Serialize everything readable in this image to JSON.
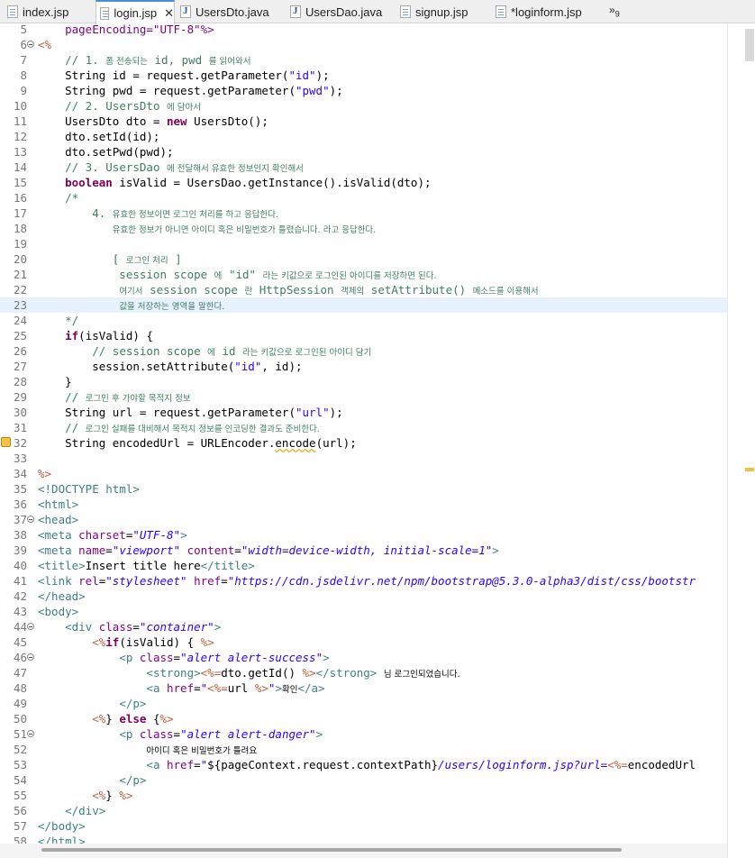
{
  "tabs": [
    {
      "label": "index.jsp",
      "icon": "jsp-file-icon"
    },
    {
      "label": "login.jsp",
      "icon": "jsp-file-icon",
      "active": true
    },
    {
      "label": "UsersDto.java",
      "icon": "java-file-icon"
    },
    {
      "label": "UsersDao.java",
      "icon": "java-file-icon"
    },
    {
      "label": "signup.jsp",
      "icon": "jsp-file-icon"
    },
    {
      "label": "*loginform.jsp",
      "icon": "jsp-file-icon"
    }
  ],
  "overflow": {
    "chevron": "»",
    "count": "9"
  },
  "colors": {
    "keyword": "#7f0055",
    "string": "#2a00ff",
    "comment": "#3f7f5f",
    "tag": "#3f7f7f",
    "attribute": "#7f007f",
    "jsp_delimiter": "#bf5f3f",
    "current_line": "#e8f2fe"
  },
  "editor": {
    "current_line": 23,
    "warning_line": 32,
    "lines": [
      {
        "n": "5",
        "segs": [
          {
            "t": "    pageEncoding=\"UTF-8\"%>",
            "c": "attr"
          }
        ]
      },
      {
        "n": "6",
        "fold": true,
        "segs": [
          {
            "t": "<%",
            "c": "jsp"
          }
        ]
      },
      {
        "n": "7",
        "segs": [
          {
            "t": "    "
          },
          {
            "t": "// 1. ",
            "c": "cm"
          },
          {
            "t": "폼 전송되는",
            "c": "cm ko"
          },
          {
            "t": " id, pwd ",
            "c": "cm"
          },
          {
            "t": "를 읽어와서",
            "c": "cm ko"
          }
        ]
      },
      {
        "n": "8",
        "segs": [
          {
            "t": "    String id = request.getParameter("
          },
          {
            "t": "\"id\"",
            "c": "str"
          },
          {
            "t": ");"
          }
        ]
      },
      {
        "n": "9",
        "segs": [
          {
            "t": "    String pwd = request.getParameter("
          },
          {
            "t": "\"pwd\"",
            "c": "str"
          },
          {
            "t": ");"
          }
        ]
      },
      {
        "n": "10",
        "segs": [
          {
            "t": "    "
          },
          {
            "t": "// 2. UsersDto ",
            "c": "cm"
          },
          {
            "t": "에 담아서",
            "c": "cm ko"
          }
        ]
      },
      {
        "n": "11",
        "segs": [
          {
            "t": "    UsersDto dto = "
          },
          {
            "t": "new",
            "c": "kw"
          },
          {
            "t": " UsersDto();"
          }
        ]
      },
      {
        "n": "12",
        "segs": [
          {
            "t": "    dto.setId(id);"
          }
        ]
      },
      {
        "n": "13",
        "segs": [
          {
            "t": "    dto.setPwd(pwd);"
          }
        ]
      },
      {
        "n": "14",
        "segs": [
          {
            "t": "    "
          },
          {
            "t": "// 3. UsersDao ",
            "c": "cm"
          },
          {
            "t": "에 전달해서 유효한 정보인지 확인해서",
            "c": "cm ko"
          }
        ]
      },
      {
        "n": "15",
        "segs": [
          {
            "t": "    "
          },
          {
            "t": "boolean",
            "c": "kw"
          },
          {
            "t": " isValid = UsersDao.getInstance().isValid(dto);"
          }
        ]
      },
      {
        "n": "16",
        "segs": [
          {
            "t": "    /*",
            "c": "cm"
          }
        ]
      },
      {
        "n": "17",
        "segs": [
          {
            "t": "        4. ",
            "c": "cm"
          },
          {
            "t": "유효한 정보이면 로그인 처리를 하고 응답한다.",
            "c": "cm ko"
          }
        ]
      },
      {
        "n": "18",
        "segs": [
          {
            "t": "           ",
            "c": "cm"
          },
          {
            "t": "유효한 정보가 아니면 아이디 혹은 비밀번호가 틀렸습니다. 라고 응답한다.",
            "c": "cm ko"
          }
        ]
      },
      {
        "n": "19",
        "segs": []
      },
      {
        "n": "20",
        "segs": [
          {
            "t": "           [ ",
            "c": "cm"
          },
          {
            "t": "로그인 처리",
            "c": "cm ko"
          },
          {
            "t": " ]",
            "c": "cm"
          }
        ]
      },
      {
        "n": "21",
        "segs": [
          {
            "t": "            session scope ",
            "c": "cm"
          },
          {
            "t": "에",
            "c": "cm ko"
          },
          {
            "t": " \"id\" ",
            "c": "cm"
          },
          {
            "t": "라는 키값으로 로그인된 아이디를 저장하면 된다.",
            "c": "cm ko"
          }
        ]
      },
      {
        "n": "22",
        "segs": [
          {
            "t": "            ",
            "c": "cm"
          },
          {
            "t": "여기서",
            "c": "cm ko"
          },
          {
            "t": " session scope ",
            "c": "cm"
          },
          {
            "t": "란",
            "c": "cm ko"
          },
          {
            "t": " HttpSession ",
            "c": "cm"
          },
          {
            "t": "객체의",
            "c": "cm ko"
          },
          {
            "t": " setAttribute() ",
            "c": "cm"
          },
          {
            "t": "메소드를 이용해서",
            "c": "cm ko"
          }
        ]
      },
      {
        "n": "23",
        "segs": [
          {
            "t": "            ",
            "c": "cm"
          },
          {
            "t": "값을 저장하는 영역을 말한다.",
            "c": "cm ko"
          }
        ]
      },
      {
        "n": "24",
        "segs": [
          {
            "t": "    */",
            "c": "cm"
          }
        ]
      },
      {
        "n": "25",
        "segs": [
          {
            "t": "    "
          },
          {
            "t": "if",
            "c": "kw"
          },
          {
            "t": "(isValid) {"
          }
        ]
      },
      {
        "n": "26",
        "segs": [
          {
            "t": "        "
          },
          {
            "t": "// session scope ",
            "c": "cm"
          },
          {
            "t": "에",
            "c": "cm ko"
          },
          {
            "t": " id ",
            "c": "cm"
          },
          {
            "t": "라는 키값으로 로그인된 아이디 담기",
            "c": "cm ko"
          }
        ]
      },
      {
        "n": "27",
        "segs": [
          {
            "t": "        session.setAttribute("
          },
          {
            "t": "\"id\"",
            "c": "str"
          },
          {
            "t": ", id);"
          }
        ]
      },
      {
        "n": "28",
        "segs": [
          {
            "t": "    }"
          }
        ]
      },
      {
        "n": "29",
        "segs": [
          {
            "t": "    "
          },
          {
            "t": "// ",
            "c": "cm"
          },
          {
            "t": "로그인 후 가야할 목적지 정보",
            "c": "cm ko"
          }
        ]
      },
      {
        "n": "30",
        "segs": [
          {
            "t": "    String url = request.getParameter("
          },
          {
            "t": "\"url\"",
            "c": "str"
          },
          {
            "t": ");"
          }
        ]
      },
      {
        "n": "31",
        "segs": [
          {
            "t": "    "
          },
          {
            "t": "// ",
            "c": "cm"
          },
          {
            "t": "로그인 실패를 대비해서 목적지 정보를 인코딩한 결과도 준비한다.",
            "c": "cm ko"
          }
        ]
      },
      {
        "n": "32",
        "warn": true,
        "segs": [
          {
            "t": "    String encodedUrl = URLEncoder."
          },
          {
            "t": "encode",
            "c": "wavy"
          },
          {
            "t": "(url);"
          }
        ]
      },
      {
        "n": "33",
        "segs": []
      },
      {
        "n": "34",
        "segs": [
          {
            "t": "%>",
            "c": "jsp"
          }
        ]
      },
      {
        "n": "35",
        "segs": [
          {
            "t": "<!DOCTYPE html>",
            "c": "tag"
          }
        ]
      },
      {
        "n": "36",
        "segs": [
          {
            "t": "<html>",
            "c": "tag"
          }
        ]
      },
      {
        "n": "37",
        "fold": true,
        "segs": [
          {
            "t": "<head>",
            "c": "tag"
          }
        ]
      },
      {
        "n": "38",
        "segs": [
          {
            "t": "<meta ",
            "c": "tag"
          },
          {
            "t": "charset",
            "c": "attr"
          },
          {
            "t": "="
          },
          {
            "t": "\"UTF-8\"",
            "c": "aval"
          },
          {
            "t": ">",
            "c": "tag"
          }
        ]
      },
      {
        "n": "39",
        "segs": [
          {
            "t": "<meta ",
            "c": "tag"
          },
          {
            "t": "name",
            "c": "attr"
          },
          {
            "t": "="
          },
          {
            "t": "\"viewport\"",
            "c": "aval"
          },
          {
            "t": " "
          },
          {
            "t": "content",
            "c": "attr"
          },
          {
            "t": "="
          },
          {
            "t": "\"width=device-width, initial-scale=1\"",
            "c": "aval"
          },
          {
            "t": ">",
            "c": "tag"
          }
        ]
      },
      {
        "n": "40",
        "segs": [
          {
            "t": "<title>",
            "c": "tag"
          },
          {
            "t": "Insert title here"
          },
          {
            "t": "</title>",
            "c": "tag"
          }
        ]
      },
      {
        "n": "41",
        "segs": [
          {
            "t": "<link ",
            "c": "tag"
          },
          {
            "t": "rel",
            "c": "attr"
          },
          {
            "t": "="
          },
          {
            "t": "\"stylesheet\"",
            "c": "aval"
          },
          {
            "t": " "
          },
          {
            "t": "href",
            "c": "attr"
          },
          {
            "t": "="
          },
          {
            "t": "\"https://cdn.jsdelivr.net/npm/bootstrap@5.3.0-alpha3/dist/css/bootstr",
            "c": "aval"
          }
        ]
      },
      {
        "n": "42",
        "segs": [
          {
            "t": "</head>",
            "c": "tag"
          }
        ]
      },
      {
        "n": "43",
        "segs": [
          {
            "t": "<body>",
            "c": "tag"
          }
        ]
      },
      {
        "n": "44",
        "fold": true,
        "segs": [
          {
            "t": "    "
          },
          {
            "t": "<div ",
            "c": "tag"
          },
          {
            "t": "class",
            "c": "attr"
          },
          {
            "t": "="
          },
          {
            "t": "\"container\"",
            "c": "aval"
          },
          {
            "t": ">",
            "c": "tag"
          }
        ]
      },
      {
        "n": "45",
        "segs": [
          {
            "t": "        "
          },
          {
            "t": "<%",
            "c": "jsp"
          },
          {
            "t": "if",
            "c": "kw"
          },
          {
            "t": "(isValid) { "
          },
          {
            "t": "%>",
            "c": "jsp"
          }
        ]
      },
      {
        "n": "46",
        "fold": true,
        "segs": [
          {
            "t": "            "
          },
          {
            "t": "<p ",
            "c": "tag"
          },
          {
            "t": "class",
            "c": "attr"
          },
          {
            "t": "="
          },
          {
            "t": "\"alert alert-success\"",
            "c": "aval"
          },
          {
            "t": ">",
            "c": "tag"
          }
        ]
      },
      {
        "n": "47",
        "segs": [
          {
            "t": "                "
          },
          {
            "t": "<strong>",
            "c": "tag"
          },
          {
            "t": "<%=",
            "c": "jsp"
          },
          {
            "t": "dto.getId() "
          },
          {
            "t": "%>",
            "c": "jsp"
          },
          {
            "t": "</strong>",
            "c": "tag"
          },
          {
            "t": " "
          },
          {
            "t": "님 로그인되었습니다.",
            "c": "ko"
          }
        ]
      },
      {
        "n": "48",
        "segs": [
          {
            "t": "                "
          },
          {
            "t": "<a ",
            "c": "tag"
          },
          {
            "t": "href",
            "c": "attr"
          },
          {
            "t": "="
          },
          {
            "t": "\"",
            "c": "aval"
          },
          {
            "t": "<%=",
            "c": "jsp"
          },
          {
            "t": "url "
          },
          {
            "t": "%>",
            "c": "jsp"
          },
          {
            "t": "\"",
            "c": "aval"
          },
          {
            "t": ">",
            "c": "tag"
          },
          {
            "t": "확인",
            "c": "ko"
          },
          {
            "t": "</a>",
            "c": "tag"
          }
        ]
      },
      {
        "n": "49",
        "segs": [
          {
            "t": "            "
          },
          {
            "t": "</p>",
            "c": "tag"
          }
        ]
      },
      {
        "n": "50",
        "segs": [
          {
            "t": "        "
          },
          {
            "t": "<%",
            "c": "jsp"
          },
          {
            "t": "} "
          },
          {
            "t": "else",
            "c": "kw"
          },
          {
            "t": " {"
          },
          {
            "t": "%>",
            "c": "jsp"
          }
        ]
      },
      {
        "n": "51",
        "fold": true,
        "segs": [
          {
            "t": "            "
          },
          {
            "t": "<p ",
            "c": "tag"
          },
          {
            "t": "class",
            "c": "attr"
          },
          {
            "t": "="
          },
          {
            "t": "\"alert alert-danger\"",
            "c": "aval"
          },
          {
            "t": ">",
            "c": "tag"
          }
        ]
      },
      {
        "n": "52",
        "segs": [
          {
            "t": "                "
          },
          {
            "t": "아이디 혹은 비밀번호가 틀려요",
            "c": "ko"
          }
        ]
      },
      {
        "n": "53",
        "segs": [
          {
            "t": "                "
          },
          {
            "t": "<a ",
            "c": "tag"
          },
          {
            "t": "href",
            "c": "attr"
          },
          {
            "t": "="
          },
          {
            "t": "\"",
            "c": "aval"
          },
          {
            "t": "${pageContext.request.contextPath}"
          },
          {
            "t": "/users/loginform.jsp?url=",
            "c": "aval"
          },
          {
            "t": "<%=",
            "c": "jsp"
          },
          {
            "t": "encodedUrl"
          }
        ]
      },
      {
        "n": "54",
        "segs": [
          {
            "t": "            "
          },
          {
            "t": "</p>",
            "c": "tag"
          }
        ]
      },
      {
        "n": "55",
        "segs": [
          {
            "t": "        "
          },
          {
            "t": "<%",
            "c": "jsp"
          },
          {
            "t": "} "
          },
          {
            "t": "%>",
            "c": "jsp"
          }
        ]
      },
      {
        "n": "56",
        "segs": [
          {
            "t": "    "
          },
          {
            "t": "</div>",
            "c": "tag"
          }
        ]
      },
      {
        "n": "57",
        "segs": [
          {
            "t": "</body>",
            "c": "tag"
          }
        ]
      },
      {
        "n": "58",
        "segs": [
          {
            "t": "</html>",
            "c": "tag"
          }
        ]
      }
    ]
  }
}
